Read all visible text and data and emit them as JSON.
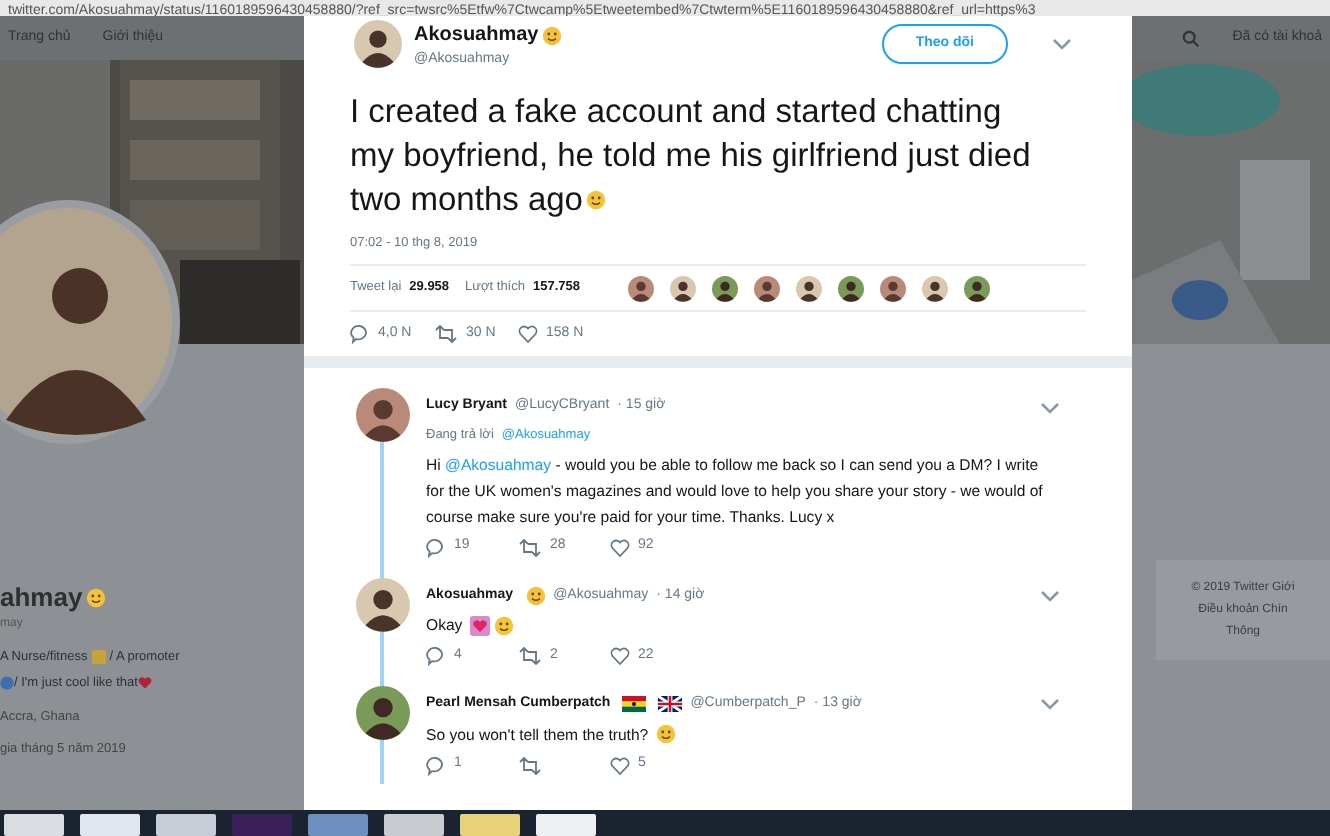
{
  "address_bar": {
    "url": "twitter.com/Akosuahmay/status/1160189596430458880/?ref_src=twsrc%5Etfw%7Ctwcamp%5Etweetembed%7Ctwterm%5E1160189596430458880&ref_url=https%3"
  },
  "nav": {
    "items": [
      "Trang chủ",
      "Giới thiệu"
    ],
    "account": "Đã có tài khoả"
  },
  "profile": {
    "name": "ahmay",
    "handle": "may",
    "bio_lines": [
      "A Nurse/fitness",
      "/ A promoter",
      "/ I'm just cool like that"
    ],
    "location": "Accra, Ghana",
    "joined": "gia tháng 5 năm 2019"
  },
  "footer": {
    "lines": [
      "© 2019 Twitter  Giới",
      "Điều khoản  Chín",
      "Thông"
    ]
  },
  "tweet": {
    "name": "Akosuahmay",
    "handle": "@Akosuahmay",
    "follow_button": "Theo dõi",
    "text": "I created a fake account and started chatting my boyfriend, he told me his girlfriend just died two months ago",
    "timestamp": "07:02 - 10 thg 8, 2019",
    "retweets_label": "Tweet lại",
    "retweets": "29.958",
    "likes_label": "Lượt thích",
    "likes": "157.758",
    "replies_count": "4,0 N",
    "retweet_count": "30 N",
    "like_count": "158 N"
  },
  "replies": [
    {
      "name": "Lucy Bryant",
      "name_emoji": false,
      "name_flags": false,
      "handle": "@LucyCBryant",
      "time": "· 15 giờ",
      "replying_label": "Đang trả lời",
      "replying_to": "@Akosuahmay",
      "text_before": "Hi ",
      "mention": "@Akosuahmay",
      "text_after": " - would you be able to follow me back so I can send you a DM? I write for the UK women's magazines and would love to help you share your story - we would of course make sure you're paid for your time. Thanks. Lucy x",
      "text_hearts": false,
      "text_emoji": false,
      "replies": "19",
      "retweets": "28",
      "likes": "92"
    },
    {
      "name": "Akosuahmay",
      "name_emoji": true,
      "name_flags": false,
      "handle": "@Akosuahmay",
      "time": "· 14 giờ",
      "text_before": "Okay",
      "text_hearts": true,
      "text_emoji": true,
      "replies": "4",
      "retweets": "2",
      "likes": "22"
    },
    {
      "name": "Pearl Mensah Cumberpatch",
      "name_emoji": false,
      "name_flags": true,
      "handle": "@Cumberpatch_P",
      "time": "· 13 giờ",
      "text_before": "So you won't tell them the truth?",
      "text_hearts": false,
      "text_emoji": true,
      "replies": "1",
      "likes": "5"
    }
  ]
}
